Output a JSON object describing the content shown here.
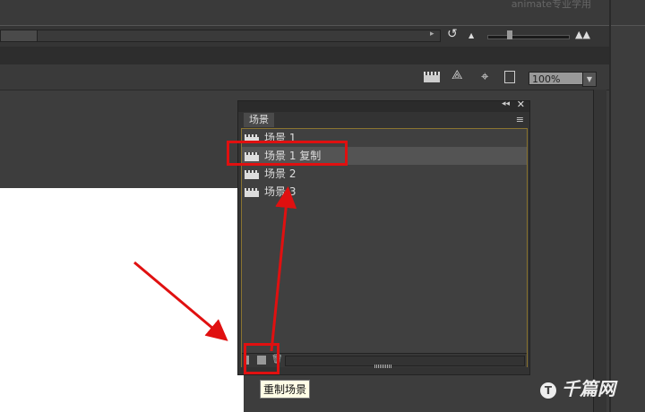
{
  "watermark_top": "animate专业学用",
  "toolbar": {
    "zoom_value": "100%",
    "icons": [
      "edit-scene-icon",
      "edit-symbol-icon",
      "snap-center-icon",
      "clip-icon"
    ]
  },
  "timeline": {
    "icons": [
      "loop-icon",
      "zoom-small-icon",
      "zoom-large-icon"
    ]
  },
  "panel": {
    "tab": "场景",
    "items": [
      {
        "label": "场景 1"
      },
      {
        "label": "场景 1 复制",
        "selected": true
      },
      {
        "label": "场景 2"
      },
      {
        "label": "场景 3"
      }
    ],
    "bottom_icons": [
      "add-scene-icon",
      "duplicate-scene-icon",
      "delete-scene-icon"
    ]
  },
  "tooltip": "重制场景",
  "annotation_color": "#e01010",
  "logo": "千篇网"
}
